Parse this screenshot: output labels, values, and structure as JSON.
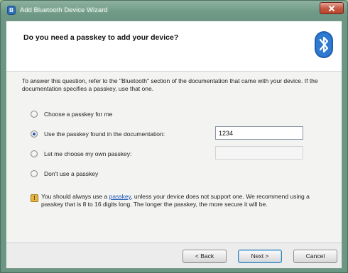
{
  "window": {
    "title": "Add Bluetooth Device Wizard",
    "title_icon": "B"
  },
  "header": {
    "title": "Do you need a passkey to add your device?",
    "logo_icon": "bluetooth-logo"
  },
  "description": "To answer this question, refer to the \"Bluetooth\" section of the documentation that came with your device. If the documentation specifies a passkey, use that one.",
  "options": [
    {
      "label": "Choose a passkey for me",
      "checked": false
    },
    {
      "label": "Use the passkey found in the documentation:",
      "checked": true
    },
    {
      "label": "Let me choose my own passkey:",
      "checked": false
    },
    {
      "label": "Don't use a passkey",
      "checked": false
    }
  ],
  "passkey_value": "1234",
  "info": {
    "icon": "info-icon",
    "icon_glyph": "!",
    "text_before": "You should always use a ",
    "link_text": "passkey",
    "text_after": ", unless your device does not support one. We recommend using a passkey that is 8 to 16 digits long. The longer the passkey, the more secure it will be."
  },
  "buttons": {
    "back": "< Back",
    "next": "Next >",
    "cancel": "Cancel"
  },
  "colors": {
    "accent": "#2d6fb4",
    "link": "#1b57b5",
    "close": "#c65a44"
  }
}
